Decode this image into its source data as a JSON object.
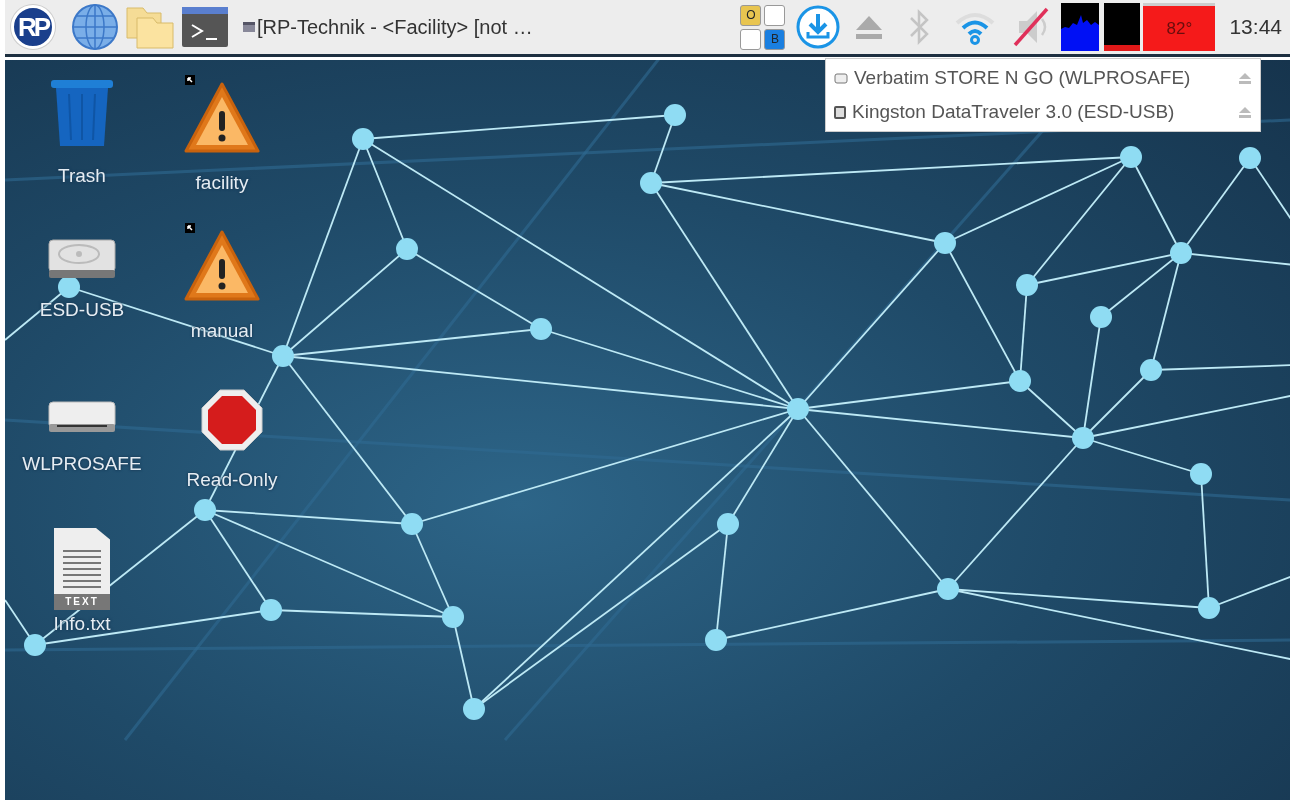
{
  "taskbar": {
    "logo_text": "RP",
    "window_button": {
      "title": "[RP-Technik - <Facility> [not …"
    },
    "keyboard_indicators": [
      {
        "label": "O",
        "color": "#e8c550"
      },
      {
        "label": "B",
        "color": "#1a7fe0"
      }
    ],
    "bluetooth": {
      "on": false
    },
    "wifi": {
      "connected": true
    },
    "volume": {
      "muted": true
    },
    "temperature": "82°",
    "clock": "13:44"
  },
  "eject_menu": {
    "items": [
      {
        "kind": "drive",
        "label": "Verbatim STORE N GO (WLPROSAFE)"
      },
      {
        "kind": "stick",
        "label": "Kingston DataTraveler 3.0 (ESD-USB)"
      }
    ]
  },
  "desktop": {
    "items": [
      {
        "kind": "trash",
        "label": "Trash",
        "shortcut": false
      },
      {
        "kind": "warning",
        "label": "facility",
        "shortcut": true
      },
      {
        "kind": "disk",
        "label": "ESD-USB",
        "shortcut": false
      },
      {
        "kind": "warning",
        "label": "manual",
        "shortcut": true
      },
      {
        "kind": "drive",
        "label": "WLPROSAFE",
        "shortcut": false
      },
      {
        "kind": "stop",
        "label": "Read-Only",
        "shortcut": false
      },
      {
        "kind": "text",
        "label": "Info.txt",
        "badge": "TEXT",
        "shortcut": false
      }
    ]
  }
}
